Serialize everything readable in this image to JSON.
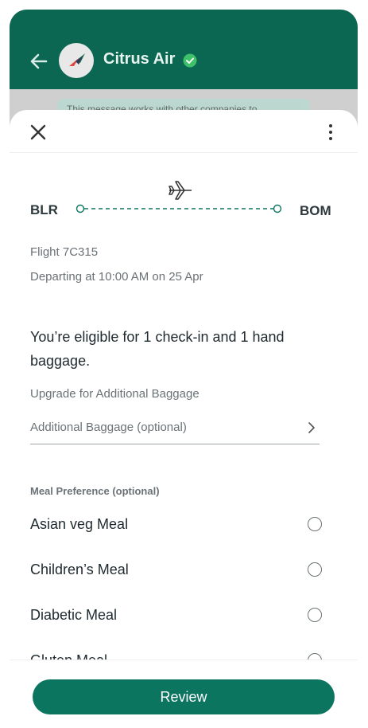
{
  "header": {
    "title": "Citrus Air",
    "verified_icon": "verified-check-icon",
    "avatar_icon": "airline-logo-icon"
  },
  "chat_banner": {
    "text": "This message works with other companies to"
  },
  "sheet": {
    "route": {
      "from": "BLR",
      "to": "BOM",
      "icon": "airplane-icon"
    },
    "flight": "Flight 7C315",
    "departure": "Departing at 10:00 AM on 25 Apr",
    "eligibility": "You’re eligible for 1 check-in and 1 hand baggage.",
    "upgrade_label": "Upgrade for Additional Baggage",
    "baggage_field": {
      "placeholder": "Additional Baggage (optional)"
    },
    "meal_preference": {
      "title": "Meal Preference (optional)",
      "options": [
        "Asian veg Meal",
        "Children’s Meal",
        "Diabetic Meal",
        "Gluten Meal"
      ]
    }
  },
  "footer": {
    "review_label": "Review"
  },
  "colors": {
    "brand": "#0b6652",
    "button": "#0b7560",
    "muted_text": "#6b7275"
  }
}
